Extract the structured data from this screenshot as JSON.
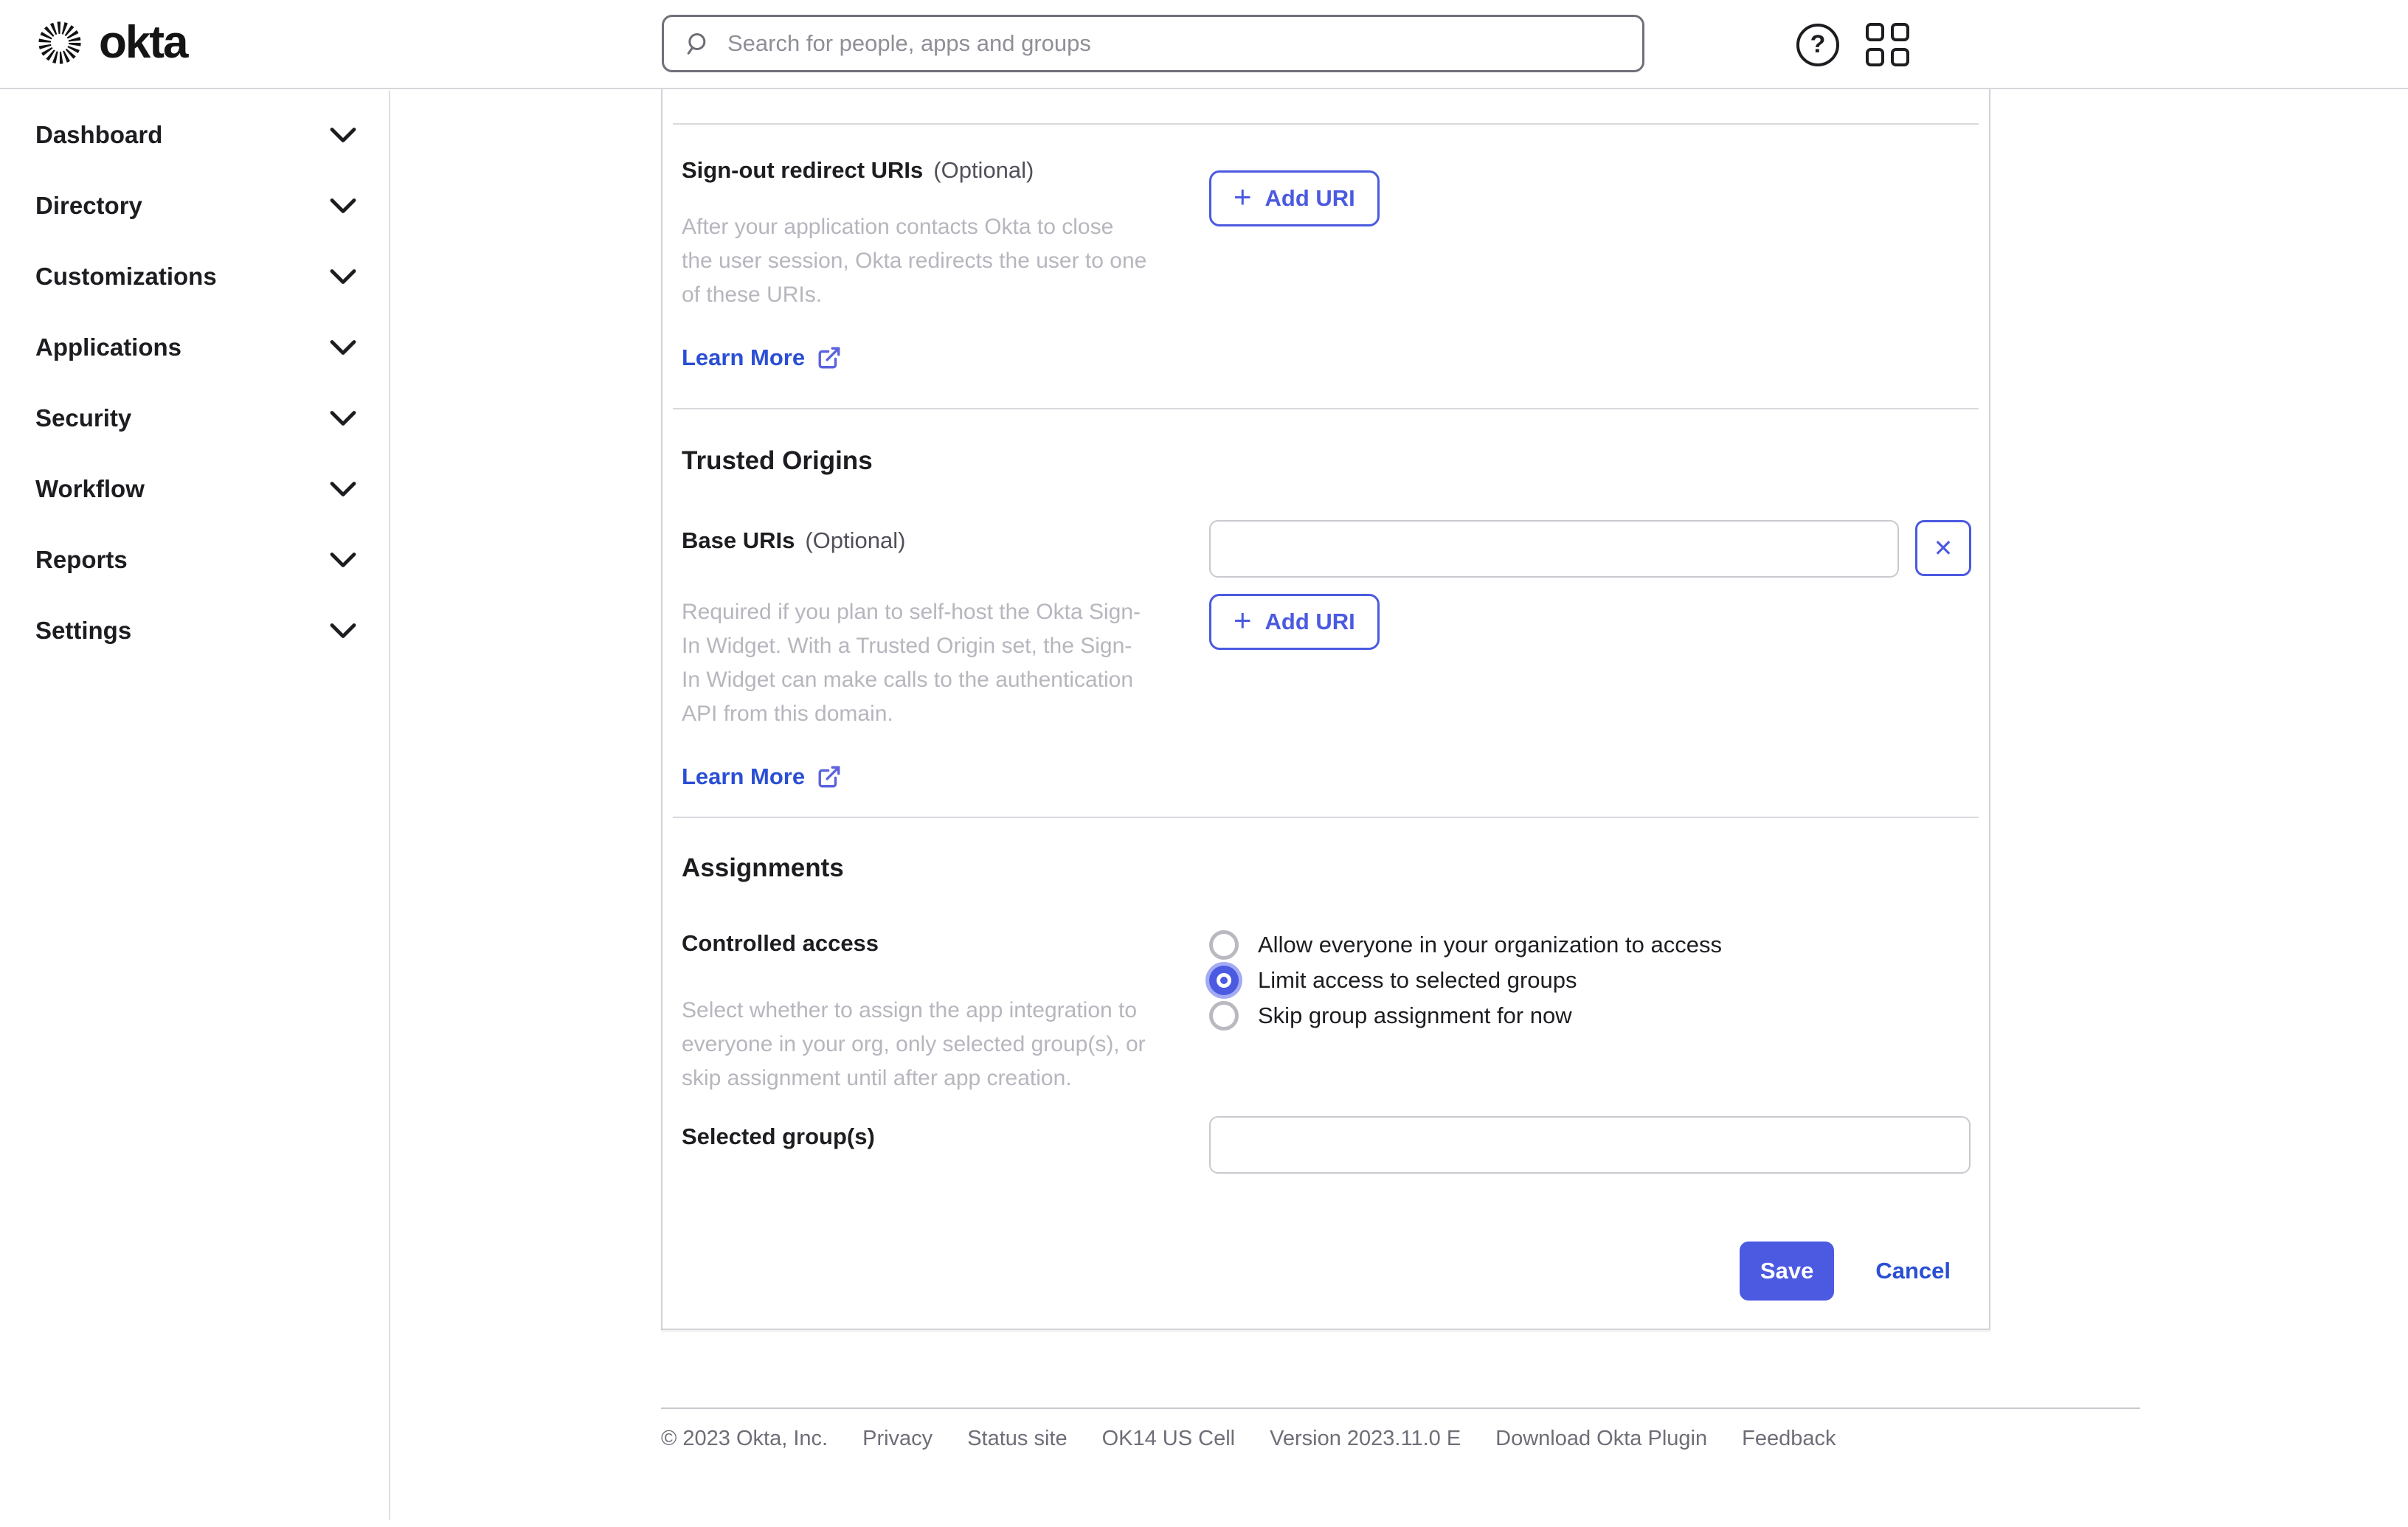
{
  "header": {
    "logo_text": "okta",
    "search": {
      "placeholder": "Search for people, apps and groups",
      "value": ""
    },
    "help_glyph": "?"
  },
  "sidebar": {
    "items": [
      "Dashboard",
      "Directory",
      "Customizations",
      "Applications",
      "Security",
      "Workflow",
      "Reports",
      "Settings"
    ]
  },
  "sections": {
    "signout": {
      "label": "Sign-out redirect URIs",
      "optional": "(Optional)",
      "description": "After your application contacts Okta to close the user session, Okta redirects the user to one of these URIs.",
      "learn_more": "Learn More",
      "add_uri": "Add URI",
      "plus_glyph": "+"
    },
    "trusted_origins": {
      "heading": "Trusted Origins",
      "base_uris_label": "Base URIs",
      "optional": "(Optional)",
      "base_uri_value": "",
      "description": "Required if you plan to self-host the Okta Sign-In Widget. With a Trusted Origin set, the Sign-In Widget can make calls to the authentication API from this domain.",
      "learn_more": "Learn More",
      "add_uri": "Add URI",
      "plus_glyph": "+",
      "remove_glyph": "✕"
    },
    "assignments": {
      "heading": "Assignments",
      "controlled_access": {
        "label": "Controlled access",
        "description": "Select whether to assign the app integration to everyone in your org, only selected group(s), or skip assignment until after app creation.",
        "options": [
          "Allow everyone in your organization to access",
          "Limit access to selected groups",
          "Skip group assignment for now"
        ],
        "selected_index": 1
      },
      "selected_groups": {
        "label": "Selected group(s)",
        "value": ""
      }
    }
  },
  "actions": {
    "save": "Save",
    "cancel": "Cancel"
  },
  "footer": {
    "items": [
      "© 2023 Okta, Inc.",
      "Privacy",
      "Status site",
      "OK14 US Cell",
      "Version 2023.11.0 E",
      "Download Okta Plugin",
      "Feedback"
    ]
  },
  "colors": {
    "primary": "#4b5ae0",
    "primary-halo": "#a3abf2",
    "link": "#2a4fd4",
    "text": "#1d1d21",
    "muted": "#b6b6be",
    "footer-text": "#6e6e78"
  }
}
